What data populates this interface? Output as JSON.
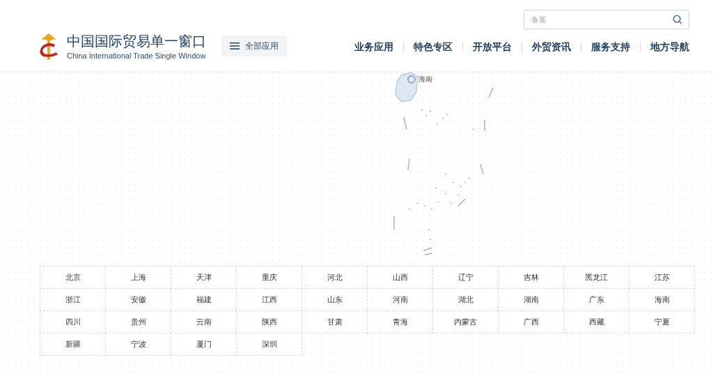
{
  "header": {
    "logo_title": "中国国际贸易单一窗口",
    "logo_subtitle": "China International Trade Single Window",
    "all_apps_button": "全部应用",
    "search": {
      "placeholder": "备案"
    },
    "nav": [
      "业务应用",
      "特色专区",
      "开放平台",
      "外贸资讯",
      "服务支持",
      "地方导航"
    ]
  },
  "map": {
    "label": "海南"
  },
  "regions": [
    "北京",
    "上海",
    "天津",
    "重庆",
    "河北",
    "山西",
    "辽宁",
    "吉林",
    "黑龙江",
    "江苏",
    "浙江",
    "安徽",
    "福建",
    "江西",
    "山东",
    "河南",
    "湖北",
    "湖南",
    "广东",
    "海南",
    "四川",
    "贵州",
    "云南",
    "陕西",
    "甘肃",
    "青海",
    "内蒙古",
    "广西",
    "西藏",
    "宁夏",
    "新疆",
    "宁波",
    "厦门",
    "深圳"
  ]
}
